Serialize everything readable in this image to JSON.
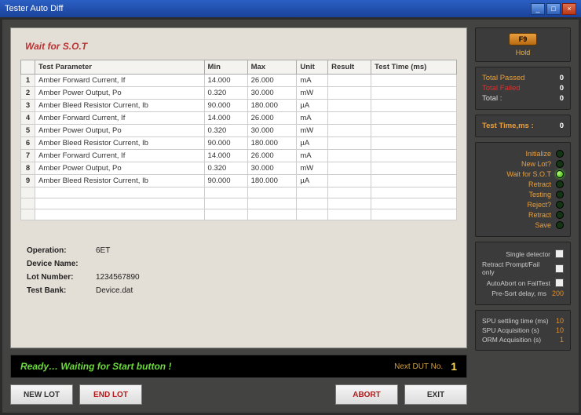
{
  "window_title": "Tester Auto Diff",
  "header_text": "Wait for S.O.T",
  "columns": [
    "Test Parameter",
    "Min",
    "Max",
    "Unit",
    "Result",
    "Test Time (ms)"
  ],
  "rows": [
    {
      "n": "1",
      "p": "Amber Forward Current, If",
      "min": "14.000",
      "max": "26.000",
      "unit": "mA",
      "res": "",
      "tt": ""
    },
    {
      "n": "2",
      "p": "Amber Power Output, Po",
      "min": "0.320",
      "max": "30.000",
      "unit": "mW",
      "res": "",
      "tt": ""
    },
    {
      "n": "3",
      "p": "Amber Bleed Resistor Current, Ib",
      "min": "90.000",
      "max": "180.000",
      "unit": "µA",
      "res": "",
      "tt": ""
    },
    {
      "n": "4",
      "p": "Amber Forward Current, If",
      "min": "14.000",
      "max": "26.000",
      "unit": "mA",
      "res": "",
      "tt": ""
    },
    {
      "n": "5",
      "p": "Amber Power Output, Po",
      "min": "0.320",
      "max": "30.000",
      "unit": "mW",
      "res": "",
      "tt": ""
    },
    {
      "n": "6",
      "p": "Amber Bleed Resistor Current, Ib",
      "min": "90.000",
      "max": "180.000",
      "unit": "µA",
      "res": "",
      "tt": ""
    },
    {
      "n": "7",
      "p": "Amber Forward Current, If",
      "min": "14.000",
      "max": "26.000",
      "unit": "mA",
      "res": "",
      "tt": ""
    },
    {
      "n": "8",
      "p": "Amber Power Output, Po",
      "min": "0.320",
      "max": "30.000",
      "unit": "mW",
      "res": "",
      "tt": ""
    },
    {
      "n": "9",
      "p": "Amber Bleed Resistor Current, Ib",
      "min": "90.000",
      "max": "180.000",
      "unit": "µA",
      "res": "",
      "tt": ""
    }
  ],
  "info": {
    "operation_label": "Operation:",
    "operation_value": "6ET",
    "device_label": "Device Name:",
    "device_value": "",
    "lot_label": "Lot Number:",
    "lot_value": "1234567890",
    "testbank_label": "Test Bank:",
    "testbank_value": "Device.dat"
  },
  "status": {
    "message": "Ready… Waiting for Start button !",
    "next_label": "Next DUT No.",
    "next_value": "1"
  },
  "buttons": {
    "newlot": "NEW LOT",
    "endlot": "END LOT",
    "abort": "ABORT",
    "exit": "EXIT"
  },
  "hold": {
    "btn": "F9",
    "label": "Hold"
  },
  "counts": {
    "passed_label": "Total Passed",
    "passed_value": "0",
    "failed_label": "Total Failed",
    "failed_value": "0",
    "total_label": "Total :",
    "total_value": "0"
  },
  "testtime": {
    "label": "Test Time,ms :",
    "value": "0"
  },
  "states": [
    "Initialize",
    "New Lot?",
    "Wait for S.O.T",
    "Retract",
    "Testing",
    "Reject?",
    "Retract",
    "Save"
  ],
  "active_state_idx": 2,
  "checks": {
    "single": "Single detector",
    "retract": "Retract Prompt/Fail only",
    "autoabort": "AutoAbort on FailTest",
    "delay_label": "Pre-Sort delay, ms",
    "delay_value": "200"
  },
  "spi": {
    "settling_label": "SPU settling time (ms)",
    "settling_value": "10",
    "acq_label": "SPU Acquisition (s)",
    "acq_value": "10",
    "orm_label": "ORM Acquisition (s)",
    "orm_value": "1"
  }
}
